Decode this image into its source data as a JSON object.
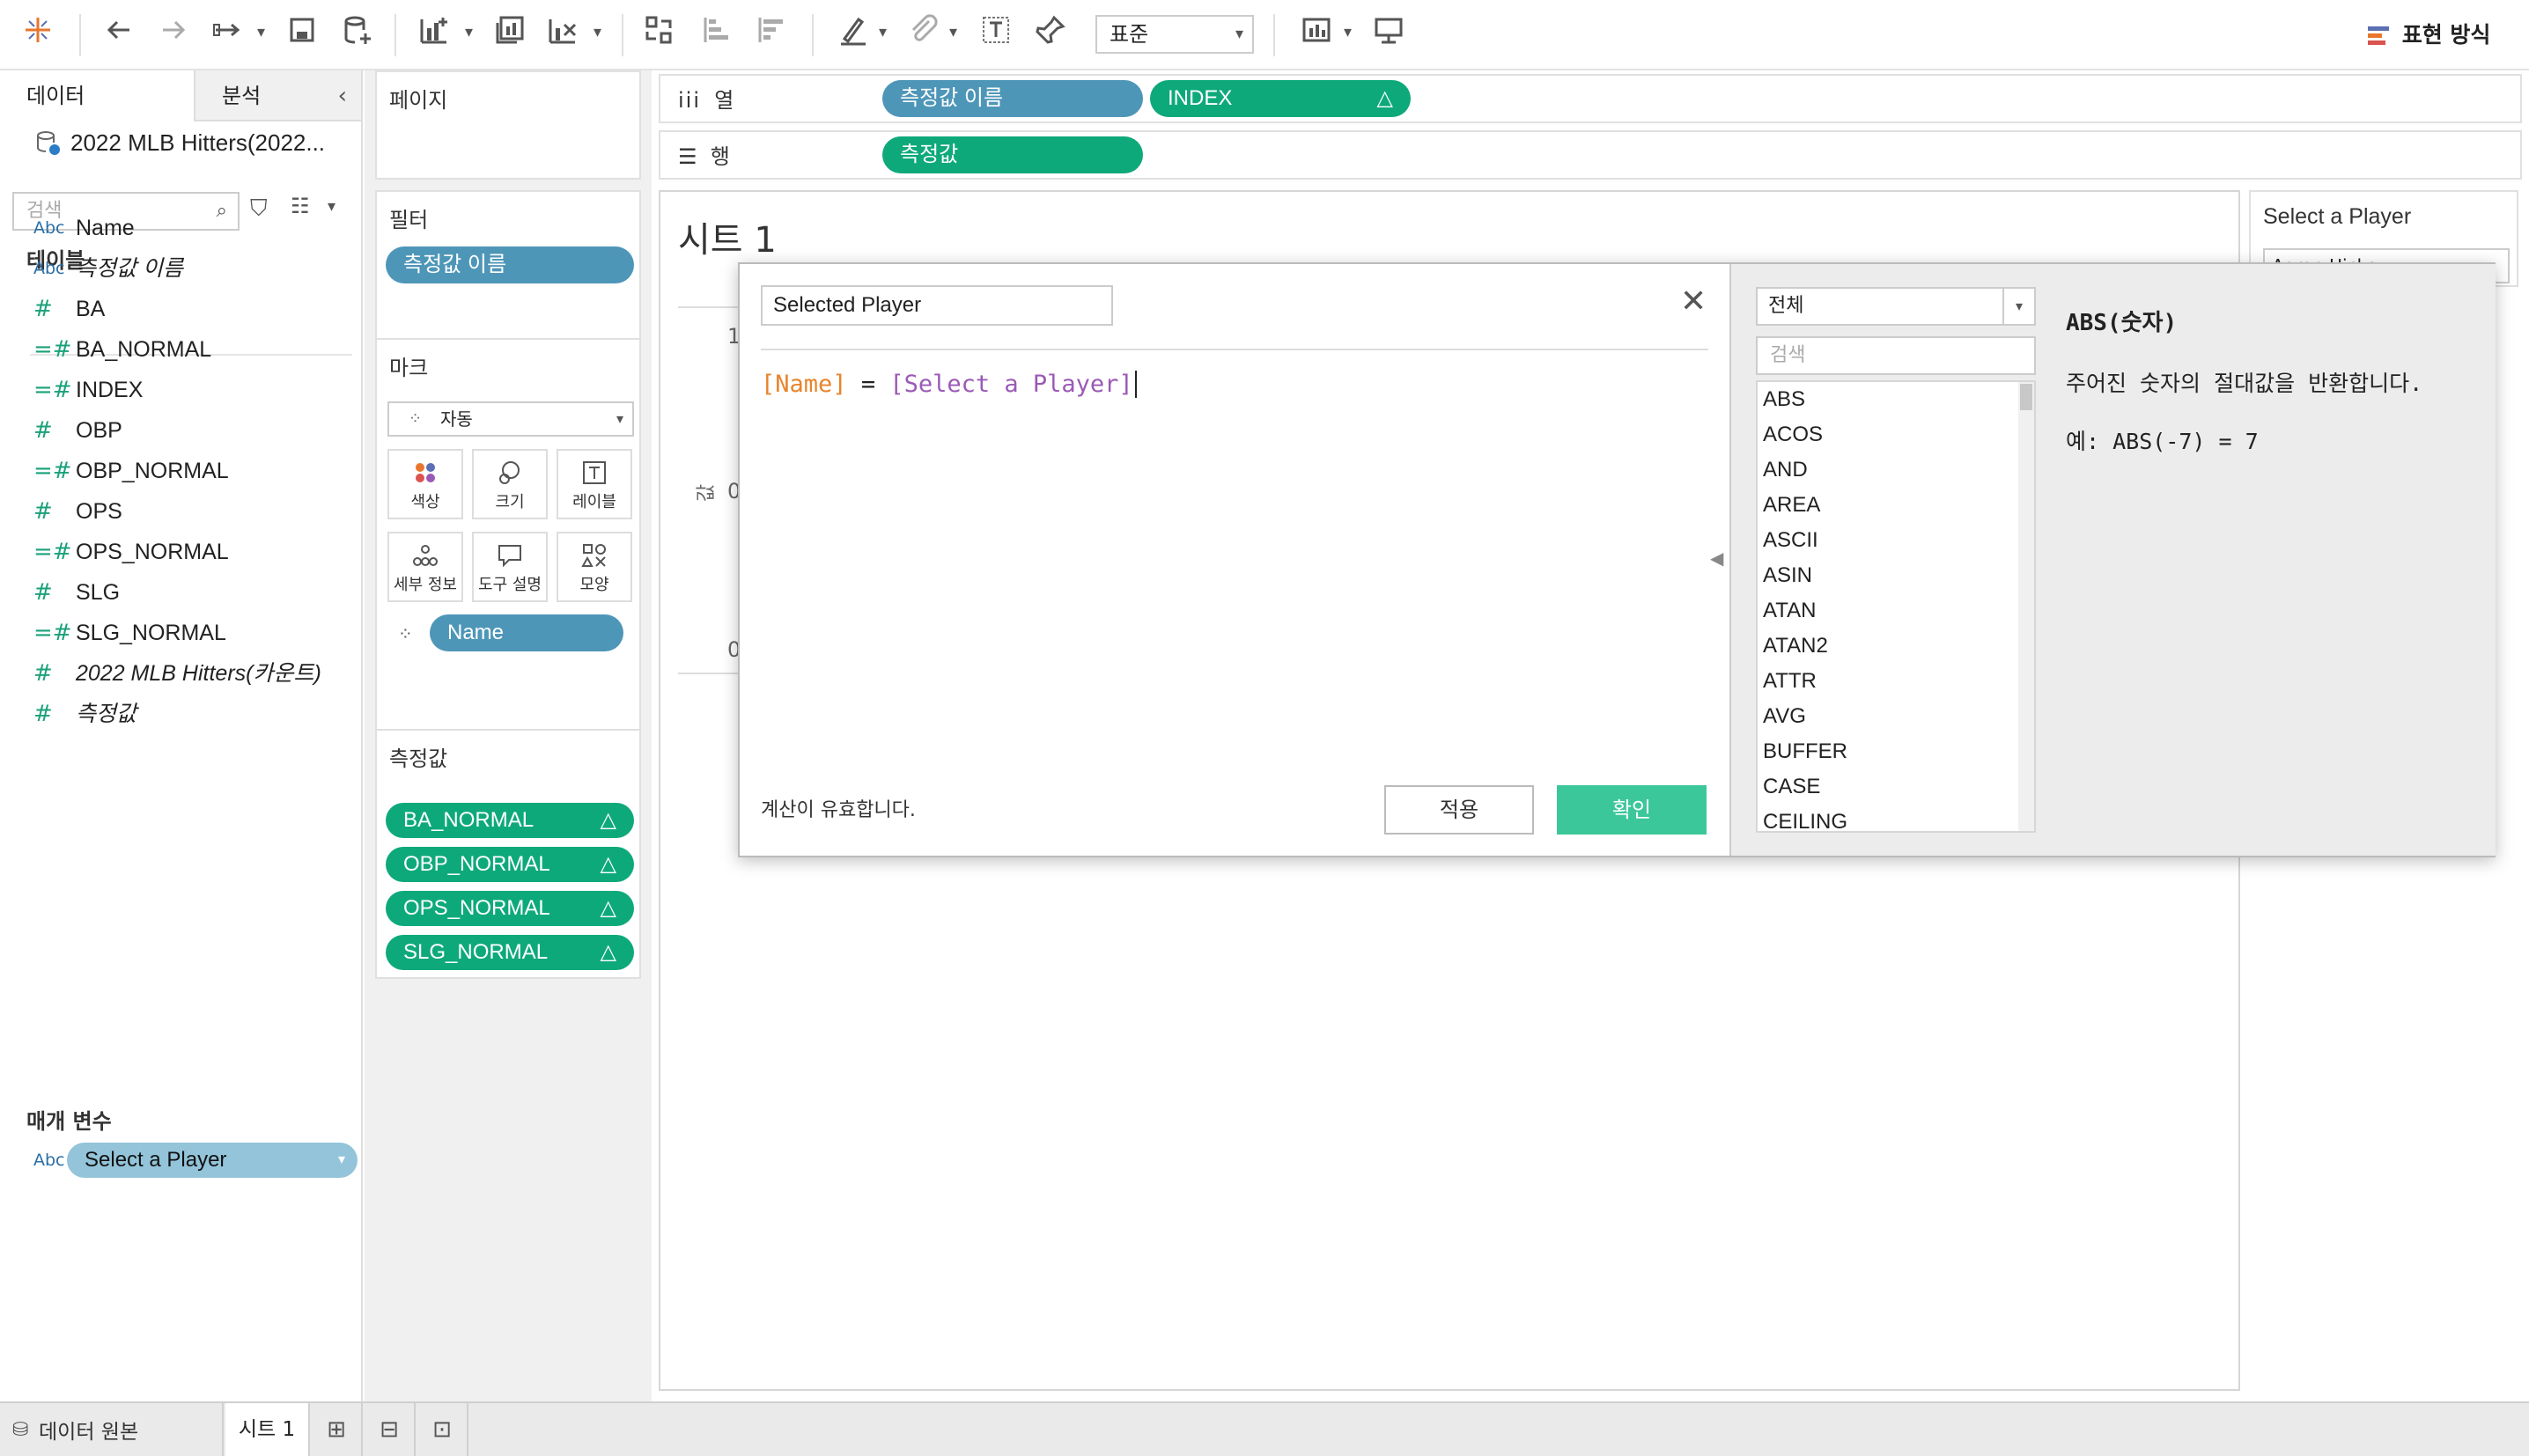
{
  "toolbar": {
    "format_select": "표준",
    "show_me": "표현 방식",
    "icons": [
      "tableau-logo-icon",
      "back-icon",
      "forward-icon",
      "redo-icon",
      "save-icon",
      "new-datasource-icon",
      "new-sheet-icon",
      "duplicate-icon",
      "clear-icon",
      "swap-icon",
      "sort-asc-icon",
      "sort-desc-icon",
      "highlight-icon",
      "group-icon",
      "label-icon",
      "pin-icon",
      "fit-icon",
      "presentation-icon"
    ]
  },
  "left_panel": {
    "tab_data": "데이터",
    "tab_analytics": "분석",
    "datasource": "2022 MLB Hitters(2022...",
    "search_placeholder": "검색",
    "tables_heading": "테이블",
    "fields": [
      {
        "type": "Abc",
        "name": "Name"
      },
      {
        "type": "Abc",
        "name": "측정값 이름"
      },
      {
        "type": "#",
        "name": "BA"
      },
      {
        "type": "=#",
        "name": "BA_NORMAL"
      },
      {
        "type": "=#",
        "name": "INDEX"
      },
      {
        "type": "#",
        "name": "OBP"
      },
      {
        "type": "=#",
        "name": "OBP_NORMAL"
      },
      {
        "type": "#",
        "name": "OPS"
      },
      {
        "type": "=#",
        "name": "OPS_NORMAL"
      },
      {
        "type": "#",
        "name": "SLG"
      },
      {
        "type": "=#",
        "name": "SLG_NORMAL"
      },
      {
        "type": "#",
        "name": "2022 MLB Hitters(카운트)"
      },
      {
        "type": "#",
        "name": "측정값"
      }
    ],
    "parameters_heading": "매개 변수",
    "parameter": {
      "type": "Abc",
      "name": "Select a Player"
    }
  },
  "cards": {
    "pages": "페이지",
    "filters": "필터",
    "filter_pill": "측정값 이름",
    "marks": "마크",
    "marks_type": "자동",
    "mark_buttons": [
      "색상",
      "크기",
      "레이블",
      "세부 정보",
      "도구 설명",
      "모양"
    ],
    "marks_pill": "Name",
    "measure_values": "측정값",
    "measure_pills": [
      "BA_NORMAL",
      "OBP_NORMAL",
      "OPS_NORMAL",
      "SLG_NORMAL"
    ]
  },
  "shelves": {
    "columns_label": "열",
    "columns_pills": [
      "측정값 이름",
      "INDEX"
    ],
    "rows_label": "행",
    "rows_pills": [
      "측정값"
    ]
  },
  "sheet": {
    "title": "시트 1",
    "axis_top": "1",
    "axis_mid": "0",
    "axis_bot": "0",
    "axis_label": "값"
  },
  "parameter_control": {
    "title": "Select a Player",
    "value": "Aaron Hicks"
  },
  "dialog": {
    "name_field": "Selected Player",
    "formula_field": "[Name]",
    "formula_op": "=",
    "formula_param": "[Select a Player]",
    "status": "계산이 유효합니다.",
    "apply_label": "적용",
    "ok_label": "확인",
    "category_select": "전체",
    "fn_search_placeholder": "검색",
    "functions": [
      "ABS",
      "ACOS",
      "AND",
      "AREA",
      "ASCII",
      "ASIN",
      "ATAN",
      "ATAN2",
      "ATTR",
      "AVG",
      "BUFFER",
      "CASE",
      "CEILING"
    ],
    "help_title": "ABS(숫자)",
    "help_desc": "주어진 숫자의 절대값을 반환합니다.",
    "help_example": "예: ABS(-7) = 7"
  },
  "bottom_bar": {
    "datasource_tab": "데이터 원본",
    "sheet_tab": "시트 1"
  },
  "colors": {
    "dimension_blue": "#4e96b8",
    "measure_green": "#0ea97a",
    "ok_button": "#3cc79a",
    "formula_field": "#e8842c",
    "formula_param": "#9b59b6"
  }
}
